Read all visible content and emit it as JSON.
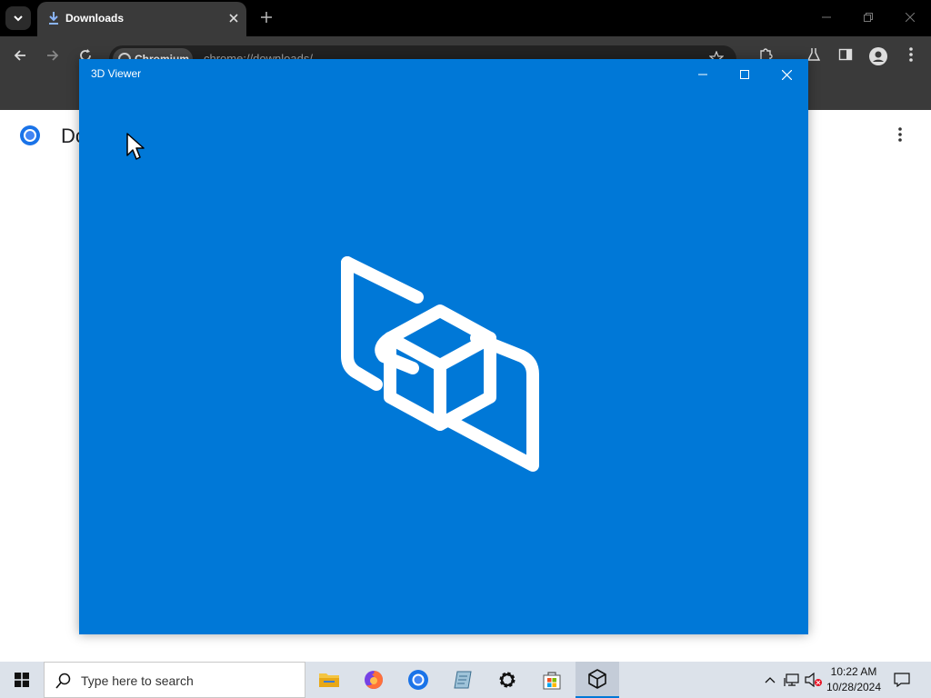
{
  "browser": {
    "tab": {
      "title": "Downloads"
    },
    "omnibox": {
      "site_chip": "Chromium",
      "url": "chrome://downloads/"
    },
    "page": {
      "title": "Do"
    }
  },
  "viewer": {
    "title": "3D Viewer",
    "background_color": "#0078d7"
  },
  "taskbar": {
    "search_placeholder": "Type here to search",
    "apps": [
      "file-explorer-icon",
      "firefox-icon",
      "chromium-icon",
      "notes-app-icon",
      "settings-icon",
      "microsoft-store-icon",
      "3d-viewer-icon"
    ],
    "clock": {
      "time": "10:22 AM",
      "date": "10/28/2024"
    }
  }
}
